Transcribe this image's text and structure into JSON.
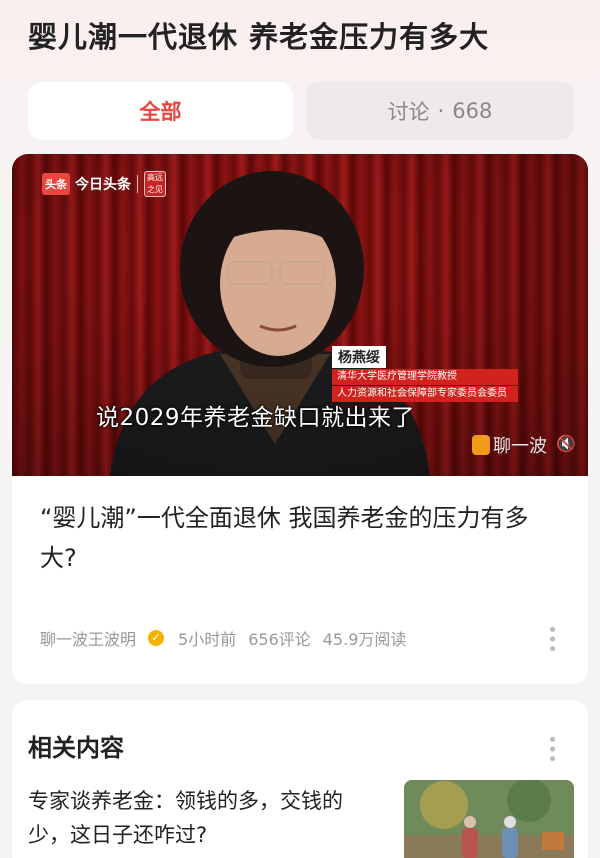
{
  "header": {
    "title": "婴儿潮一代退休 养老金压力有多大"
  },
  "tabs": {
    "all_label": "全部",
    "discuss_label": "讨论",
    "discuss_separator": "·",
    "discuss_count": "668"
  },
  "article": {
    "video": {
      "source_badge": "头条",
      "source_name": "今日头条",
      "seal_text": "高远之见",
      "person_name": "杨燕绥",
      "person_role_1": "清华大学医疗管理学院教授",
      "person_role_2": "人力资源和社会保障部专家委员会委员",
      "subtitle": "说2029年养老金缺口就出来了",
      "watermark": "聊一波"
    },
    "headline": "“婴儿潮”一代全面退休 我国养老金的压力有多大?",
    "author": "聊一波王波明",
    "time": "5小时前",
    "comments": "656评论",
    "reads": "45.9万阅读"
  },
  "related": {
    "title": "相关内容",
    "item_text": "专家谈养老金：领钱的多，交钱的少，这日子还咋过?"
  },
  "colors": {
    "accent": "#e8463e",
    "curtain": "#8c1414"
  },
  "icons": [
    "verified-badge-icon",
    "more-dots-icon",
    "mute-icon",
    "play-pause-icon"
  ]
}
